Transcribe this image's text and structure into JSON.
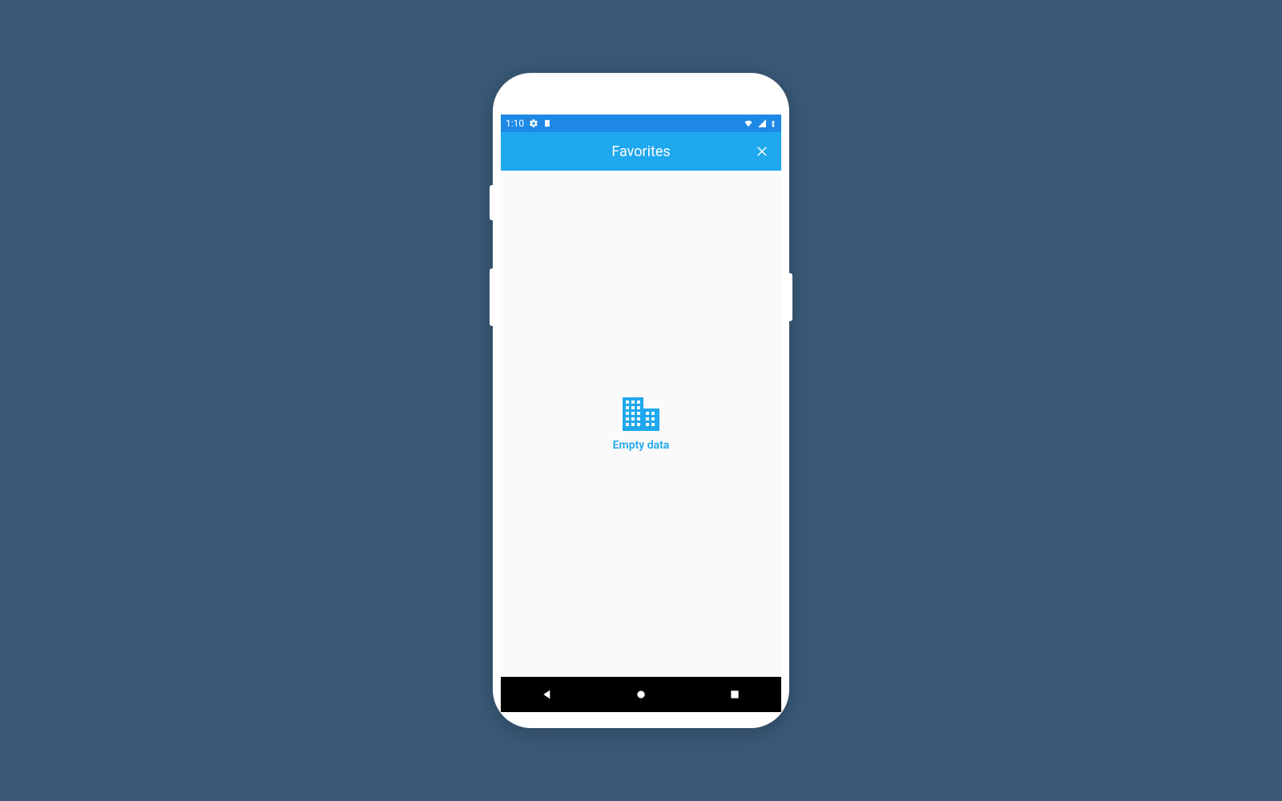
{
  "statusbar": {
    "time": "1:10"
  },
  "appbar": {
    "title": "Favorites"
  },
  "content": {
    "empty_label": "Empty data"
  },
  "colors": {
    "statusbar_bg": "#1e88e5",
    "appbar_bg": "#1fa8ee",
    "accent": "#1fa8ee"
  }
}
